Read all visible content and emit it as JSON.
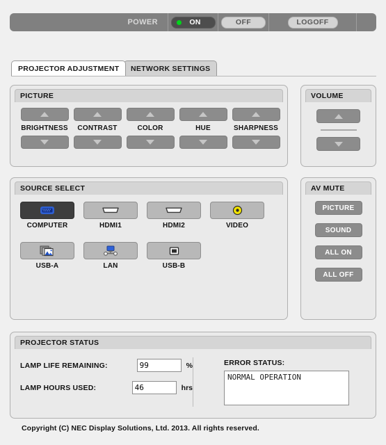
{
  "topbar": {
    "power_label": "POWER",
    "on_label": "ON",
    "off_label": "OFF",
    "logoff_label": "LOGOFF",
    "led_color": "#00d41a",
    "bar_color": "#808080"
  },
  "tabs": [
    {
      "label": "PROJECTOR ADJUSTMENT",
      "active": true
    },
    {
      "label": "NETWORK SETTINGS",
      "active": false
    }
  ],
  "picture": {
    "title": "PICTURE",
    "controls": [
      {
        "label": "BRIGHTNESS"
      },
      {
        "label": "CONTRAST"
      },
      {
        "label": "COLOR"
      },
      {
        "label": "HUE"
      },
      {
        "label": "SHARPNESS"
      }
    ],
    "up_icon": "triangle-up-icon",
    "down_icon": "triangle-down-icon"
  },
  "volume": {
    "title": "VOLUME",
    "up_icon": "triangle-up-icon",
    "down_icon": "triangle-down-icon"
  },
  "source_select": {
    "title": "SOURCE SELECT",
    "row1": [
      {
        "label": "COMPUTER",
        "icon": "vga-connector-icon",
        "selected": true
      },
      {
        "label": "HDMI1",
        "icon": "hdmi-connector-icon",
        "selected": false
      },
      {
        "label": "HDMI2",
        "icon": "hdmi-connector-icon",
        "selected": false
      },
      {
        "label": "VIDEO",
        "icon": "rca-connector-icon",
        "selected": false
      }
    ],
    "row2": [
      {
        "label": "USB-A",
        "icon": "usb-viewer-icon",
        "selected": false
      },
      {
        "label": "LAN",
        "icon": "network-icon",
        "selected": false
      },
      {
        "label": "USB-B",
        "icon": "usb-b-connector-icon",
        "selected": false
      }
    ]
  },
  "av_mute": {
    "title": "AV MUTE",
    "buttons": [
      {
        "label": "PICTURE"
      },
      {
        "label": "SOUND"
      },
      {
        "label": "ALL ON"
      },
      {
        "label": "ALL OFF"
      }
    ]
  },
  "projector_status": {
    "title": "PROJECTOR STATUS",
    "lamp_life_label": "LAMP LIFE REMAINING:",
    "lamp_life_value": "99",
    "lamp_life_unit": "%",
    "lamp_hours_label": "LAMP HOURS USED:",
    "lamp_hours_value": "46",
    "lamp_hours_unit": "hrs",
    "error_status_label": "ERROR STATUS:",
    "error_status_value": "NORMAL OPERATION"
  },
  "footer": {
    "copyright": "Copyright (C) NEC Display Solutions, Ltd. 2013. All rights reserved."
  }
}
